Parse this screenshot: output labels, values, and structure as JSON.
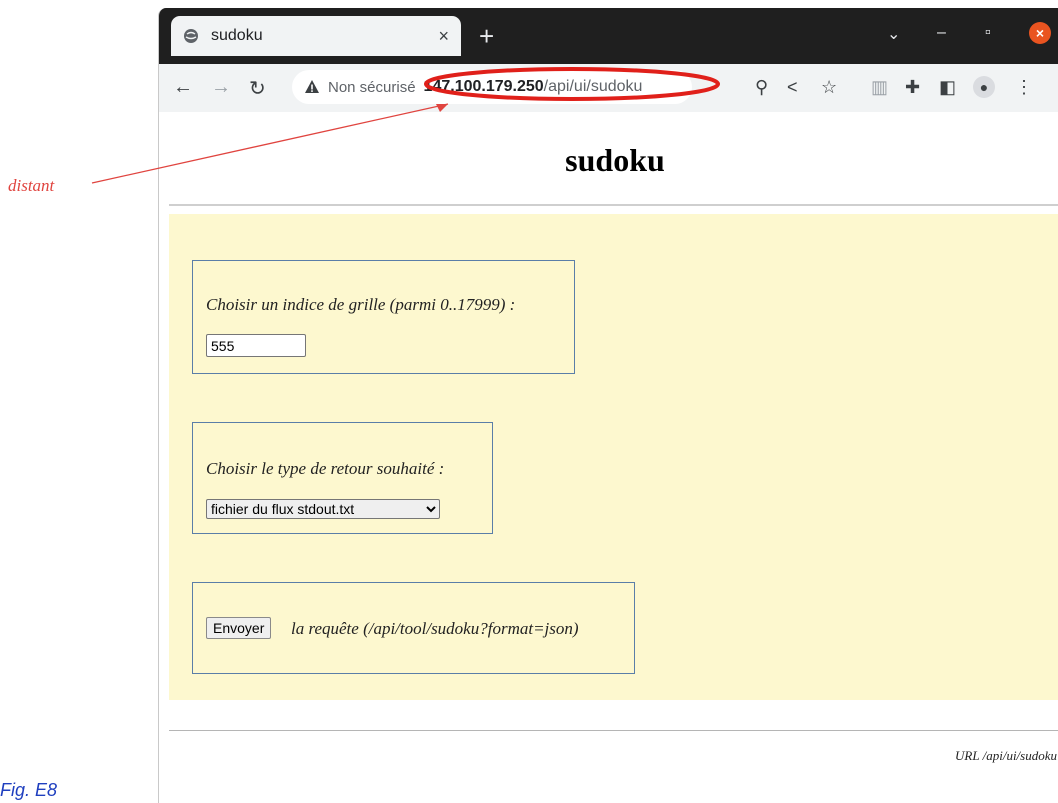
{
  "annotation": {
    "label": "distant",
    "caption": "Fig. E8"
  },
  "browser": {
    "tab": {
      "title": "sudoku",
      "close": "×"
    },
    "new_tab": "+",
    "address": {
      "security_label": "Non sécurisé",
      "host": "147.100.179.250",
      "path": "/api/ui/sudoku"
    }
  },
  "page": {
    "title": "sudoku",
    "grid_index": {
      "label": "Choisir un indice de grille (parmi 0..17999) :",
      "value": "555"
    },
    "return_type": {
      "label": "Choisir le type de retour souhaité :",
      "selected": "fichier du flux stdout.txt"
    },
    "submit": {
      "button": "Envoyer",
      "text": "la requête (/api/tool/sudoku?format=json)"
    },
    "footer_url": "URL /api/ui/sudoku"
  },
  "colors": {
    "annotation_red": "#e0443f",
    "caption_blue": "#1f3fbf",
    "panel_yellow": "#fdf8cf"
  }
}
